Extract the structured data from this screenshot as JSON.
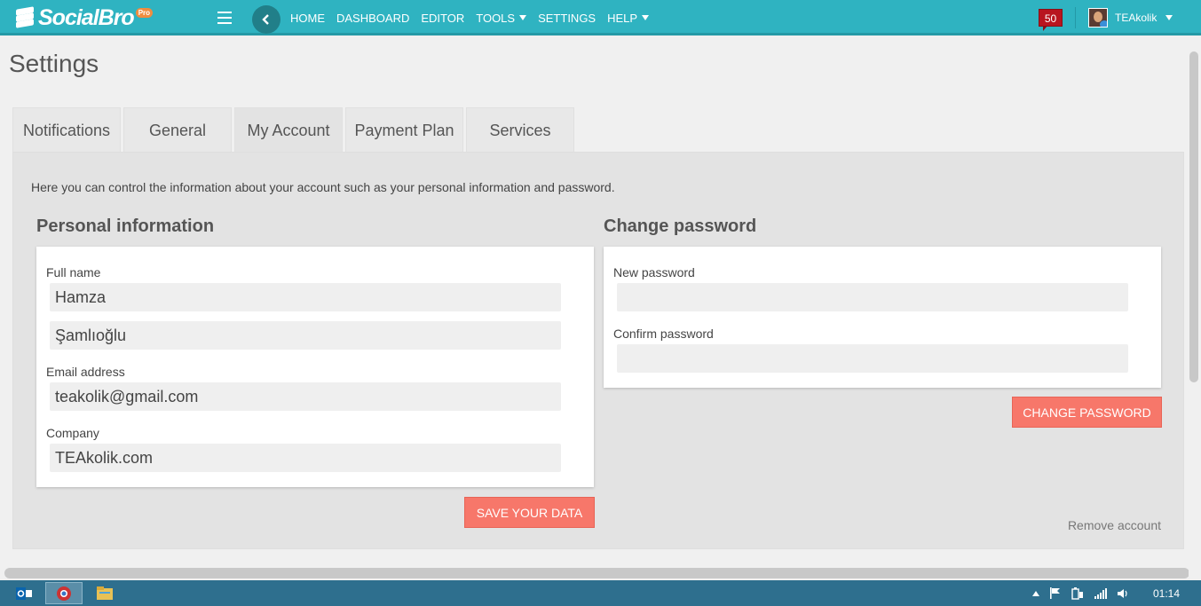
{
  "brand": {
    "name": "SocialBro",
    "badge": "Pro"
  },
  "nav": {
    "back_icon": "chevron-left-icon",
    "items": [
      {
        "label": "HOME",
        "dropdown": false
      },
      {
        "label": "DASHBOARD",
        "dropdown": false
      },
      {
        "label": "EDITOR",
        "dropdown": false
      },
      {
        "label": "TOOLS",
        "dropdown": true
      },
      {
        "label": "SETTINGS",
        "dropdown": false
      },
      {
        "label": "HELP",
        "dropdown": true
      }
    ],
    "notifications_count": "50",
    "username": "TEAkolik"
  },
  "page": {
    "title": "Settings",
    "tabs": [
      "Notifications",
      "General",
      "My Account",
      "Payment Plan",
      "Services"
    ],
    "active_tab": "My Account",
    "intro": "Here you can control the information about your account such as your personal information and password."
  },
  "personal": {
    "title": "Personal information",
    "full_name_label": "Full name",
    "first_name": "Hamza",
    "last_name": "Şamlıoğlu",
    "email_label": "Email address",
    "email": "teakolik@gmail.com",
    "company_label": "Company",
    "company": "TEAkolik.com",
    "save_label": "SAVE YOUR DATA"
  },
  "password": {
    "title": "Change password",
    "new_label": "New password",
    "new_value": "",
    "confirm_label": "Confirm password",
    "confirm_value": "",
    "change_label": "CHANGE PASSWORD"
  },
  "remove_account": "Remove account",
  "taskbar": {
    "apps": [
      "outlook-icon",
      "chrome-icon",
      "file-explorer-icon"
    ],
    "tray_icons": [
      "tray-up-arrow-icon",
      "action-center-flag-icon",
      "battery-icon",
      "signal-icon",
      "volume-icon"
    ],
    "clock": "01:14"
  },
  "colors": {
    "topbar": "#2fb3c1",
    "accent_button": "#f7776a",
    "notification_badge": "#b8151f",
    "taskbar": "#2e6f8e"
  }
}
